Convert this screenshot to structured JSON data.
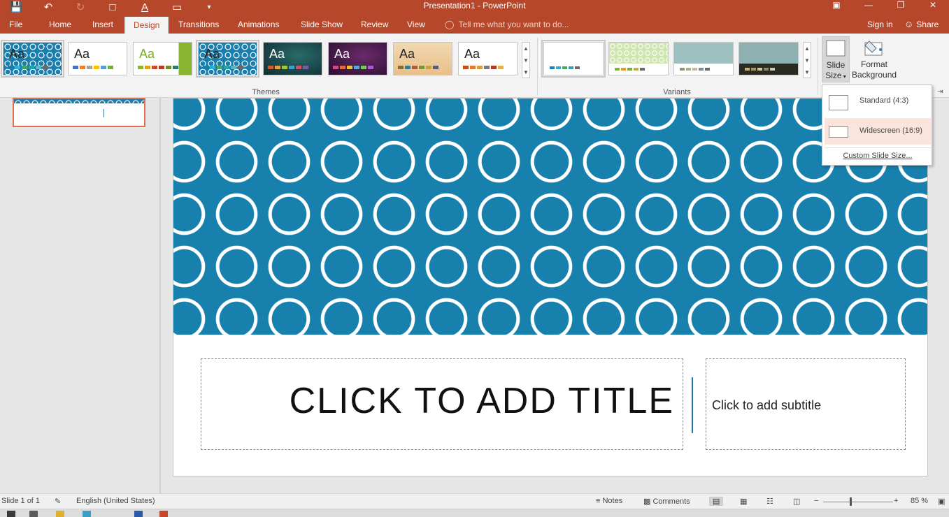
{
  "window": {
    "title": "Presentation1 - PowerPoint"
  },
  "tabs": {
    "file": "File",
    "home": "Home",
    "insert": "Insert",
    "design": "Design",
    "transitions": "Transitions",
    "animations": "Animations",
    "slideshow": "Slide Show",
    "review": "Review",
    "view": "View"
  },
  "tell_me": "Tell me what you want to do...",
  "sign_in": "Sign in",
  "share": "Share",
  "ribbon": {
    "themes_label": "Themes",
    "variants_label": "Variants",
    "theme_aa": "Aa",
    "slide_size_label1": "Slide",
    "slide_size_label2": "Size",
    "format_bg_label1": "Format",
    "format_bg_label2": "Background"
  },
  "slide_size_menu": {
    "standard": "Standard (4:3)",
    "widescreen": "Widescreen (16:9)",
    "custom": "Custom Slide Size..."
  },
  "slide": {
    "title_placeholder": "CLICK TO ADD TITLE",
    "subtitle_placeholder": "Click to add subtitle"
  },
  "status": {
    "slide_info": "Slide 1 of 1",
    "language": "English (United States)",
    "notes": "Notes",
    "comments": "Comments",
    "zoom": "85 %",
    "zoom_minus": "−",
    "zoom_plus": "+"
  },
  "colors": {
    "accent": "#b7472a",
    "slide_blue": "#1780ad",
    "hover_bg": "#fbe4dc"
  },
  "icons": {
    "save": "save-icon",
    "undo": "undo-icon",
    "redo": "redo-icon",
    "present": "present-from-beginning-icon",
    "font_color": "font-color-icon",
    "new_slide": "new-slide-icon",
    "customize": "customize-qat-icon",
    "restore": "ribbon-display-icon",
    "minimize": "minimize-icon",
    "maximize": "restore-down-icon",
    "close": "close-icon"
  }
}
